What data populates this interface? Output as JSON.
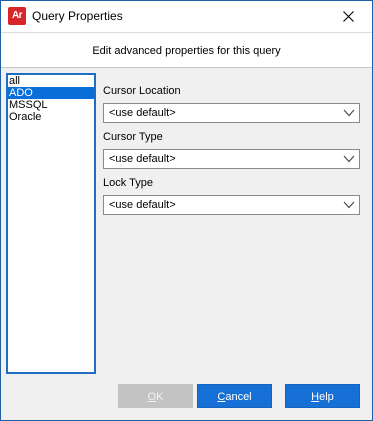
{
  "window": {
    "title": "Query Properties",
    "app_icon_text": "Ar"
  },
  "header": {
    "text": "Edit advanced properties for this query"
  },
  "providers": {
    "items": [
      {
        "label": "all",
        "selected": false
      },
      {
        "label": "ADO",
        "selected": true
      },
      {
        "label": "MSSQL",
        "selected": false
      },
      {
        "label": "Oracle",
        "selected": false
      }
    ]
  },
  "fields": {
    "cursor_location": {
      "label": "Cursor Location",
      "value": "<use default>"
    },
    "cursor_type": {
      "label": "Cursor Type",
      "value": "<use default>"
    },
    "lock_type": {
      "label": "Lock Type",
      "value": "<use default>"
    }
  },
  "buttons": {
    "ok": {
      "mnemonic": "O",
      "rest": "K",
      "enabled": false
    },
    "cancel": {
      "mnemonic": "C",
      "rest": "ancel",
      "enabled": true
    },
    "help": {
      "mnemonic": "H",
      "rest": "elp",
      "enabled": true
    }
  },
  "colors": {
    "accent": "#1670d6",
    "selection": "#0a6ed8",
    "app_icon": "#d7262a"
  }
}
